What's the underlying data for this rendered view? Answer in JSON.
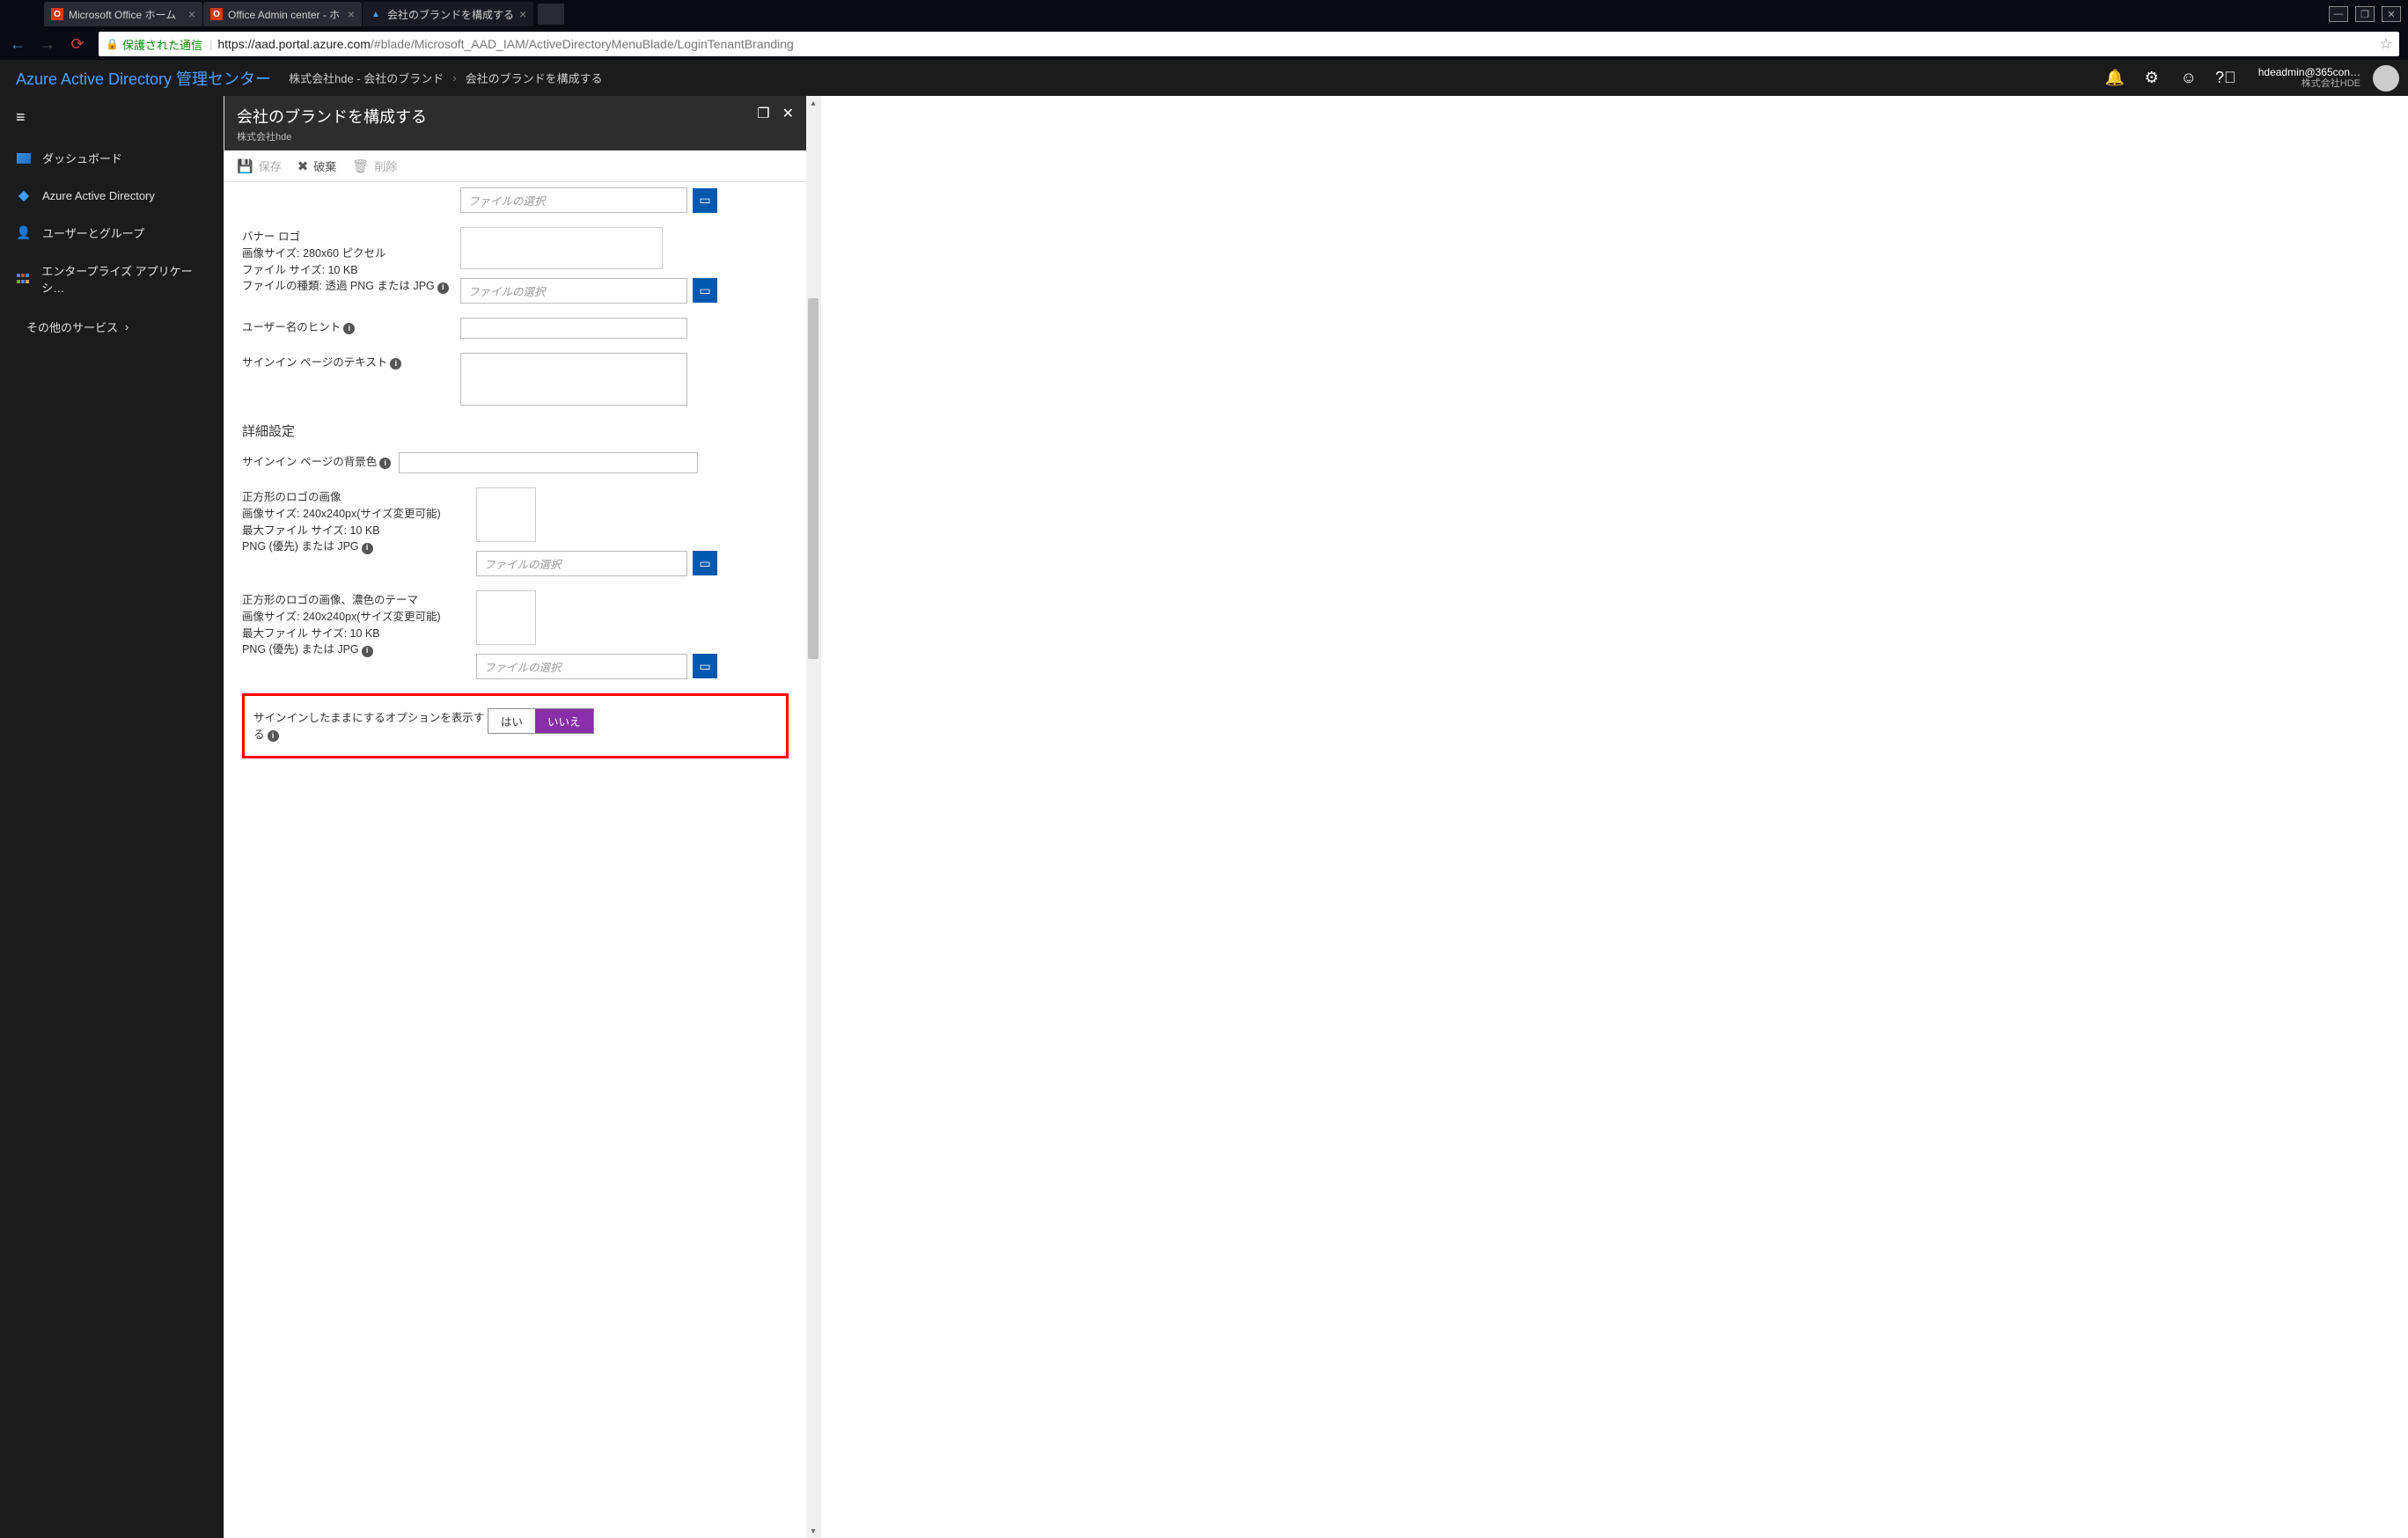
{
  "browser": {
    "tabs": [
      {
        "title": "Microsoft Office ホーム",
        "favicon": "o"
      },
      {
        "title": "Office Admin center - ホ",
        "favicon": "o"
      },
      {
        "title": "会社のブランドを構成する",
        "favicon": "a",
        "active": true
      }
    ],
    "secure_label": "保護された通信",
    "url_host": "https://aad.portal.azure.com",
    "url_path": "/#blade/Microsoft_AAD_IAM/ActiveDirectoryMenuBlade/LoginTenantBranding"
  },
  "header": {
    "logo": "Azure Active Directory 管理センター",
    "breadcrumb": [
      "株式会社hde - 会社のブランド",
      "会社のブランドを構成する"
    ],
    "user_email": "hdeadmin@365con…",
    "user_org": "株式会社HDE"
  },
  "sidebar": {
    "items": [
      {
        "label": "ダッシュボード",
        "icon": "dashboard"
      },
      {
        "label": "Azure Active Directory",
        "icon": "aad"
      },
      {
        "label": "ユーザーとグループ",
        "icon": "users"
      },
      {
        "label": "エンタープライズ アプリケーシ…",
        "icon": "apps"
      }
    ],
    "other": "その他のサービス"
  },
  "blade": {
    "title": "会社のブランドを構成する",
    "subtitle": "株式会社hde",
    "toolbar": {
      "save": "保存",
      "discard": "破棄",
      "delete": "削除"
    },
    "file_placeholder": "ファイルの選択",
    "fields": {
      "banner_logo": {
        "label": "バナー ロゴ",
        "size": "画像サイズ: 280x60 ピクセル",
        "filesize": "ファイル サイズ: 10 KB",
        "filetype": "ファイルの種類: 透過 PNG または JPG"
      },
      "username_hint": {
        "label": "ユーザー名のヒント"
      },
      "signin_text": {
        "label": "サインイン ページのテキスト"
      },
      "section_advanced": "詳細設定",
      "bg_color": {
        "label": "サインイン ページの背景色"
      },
      "square_logo": {
        "label": "正方形のロゴの画像",
        "size": "画像サイズ: 240x240px(サイズ変更可能)",
        "filesize": "最大ファイル サイズ: 10 KB",
        "filetype": "PNG (優先) または JPG"
      },
      "square_logo_dark": {
        "label": "正方形のロゴの画像、濃色のテーマ",
        "size": "画像サイズ: 240x240px(サイズ変更可能)",
        "filesize": "最大ファイル サイズ: 10 KB",
        "filetype": "PNG (優先) または JPG"
      },
      "stay_signed_in": {
        "label": "サインインしたままにするオプションを表示する",
        "yes": "はい",
        "no": "いいえ"
      }
    }
  }
}
